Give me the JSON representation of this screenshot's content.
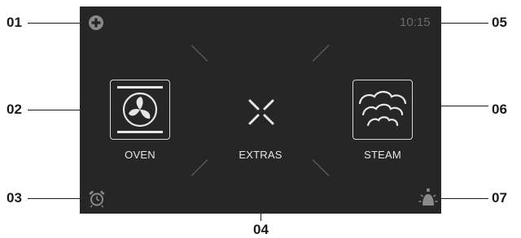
{
  "screen": {
    "time": "10:15",
    "modes": {
      "oven": {
        "label": "OVEN",
        "icon": "fan-icon"
      },
      "extras": {
        "label": "EXTRAS",
        "icon": "extras-icon"
      },
      "steam": {
        "label": "STEAM",
        "icon": "steam-clouds-icon"
      }
    },
    "corner_icons": {
      "top_left": "plus-circle-icon",
      "bottom_left": "alarm-clock-icon",
      "bottom_right": "light-bulb-icon"
    }
  },
  "callouts": [
    "01",
    "02",
    "03",
    "04",
    "05",
    "06",
    "07"
  ],
  "colors": {
    "screen_background": "#262626",
    "icon_foreground": "#e6e6e6",
    "clock_text": "#6b6b6b",
    "callout_text": "#1a1a1a"
  }
}
